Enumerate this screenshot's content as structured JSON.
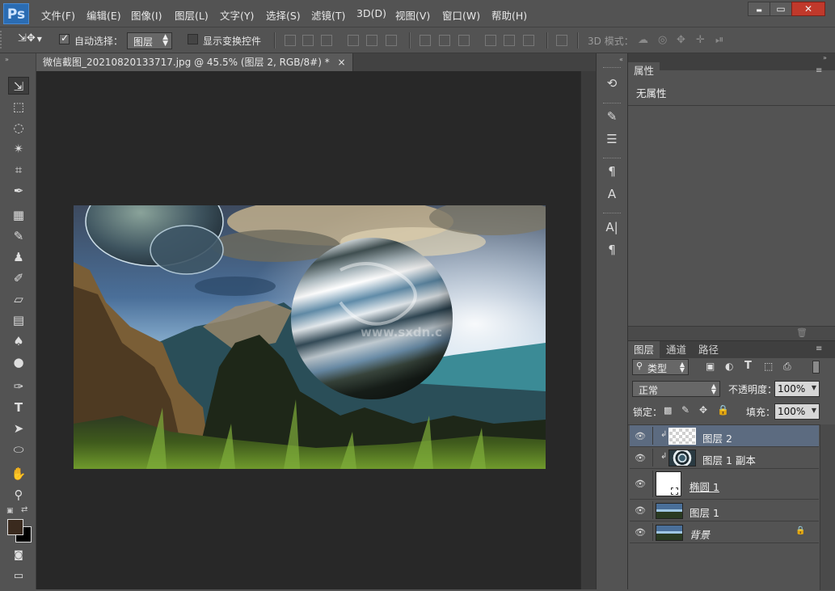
{
  "app": {
    "logo": "Ps"
  },
  "menu": [
    "文件(F)",
    "编辑(E)",
    "图像(I)",
    "图层(L)",
    "文字(Y)",
    "选择(S)",
    "滤镜(T)",
    "3D(D)",
    "视图(V)",
    "窗口(W)",
    "帮助(H)"
  ],
  "window_controls": {
    "minimize": "▬",
    "maximize": "▭",
    "close": "✕"
  },
  "options": {
    "auto_select_label": "自动选择：",
    "auto_select_value": "图层",
    "show_transform_label": "显示变换控件",
    "mode_3d_label": "3D 模式："
  },
  "document": {
    "tab_title": "微信截图_20210820133717.jpg @ 45.5% (图层 2, RGB/8#) *",
    "tab_close": "×",
    "watermark": "www.sxdn.c"
  },
  "properties": {
    "title": "属性",
    "content": "无属性"
  },
  "layers": {
    "tabs": [
      "图层",
      "通道",
      "路径"
    ],
    "filter_label": "类型",
    "blend_mode": "正常",
    "opacity_label": "不透明度：",
    "opacity_value": "100%",
    "lock_label": "锁定：",
    "fill_label": "填充：",
    "fill_value": "100%",
    "items": [
      {
        "name": "图层 2",
        "selected": true,
        "clipped": true
      },
      {
        "name": "图层 1 副本",
        "selected": false,
        "clipped": true
      },
      {
        "name": "椭圆 1",
        "selected": false,
        "clipped": false
      },
      {
        "name": "图层 1",
        "selected": false,
        "clipped": false
      },
      {
        "name": "背景",
        "selected": false,
        "clipped": false,
        "locked": true
      }
    ]
  },
  "colors": {
    "foreground": "#3a2a1e",
    "background": "#000000",
    "selection": "#5c6b80"
  }
}
